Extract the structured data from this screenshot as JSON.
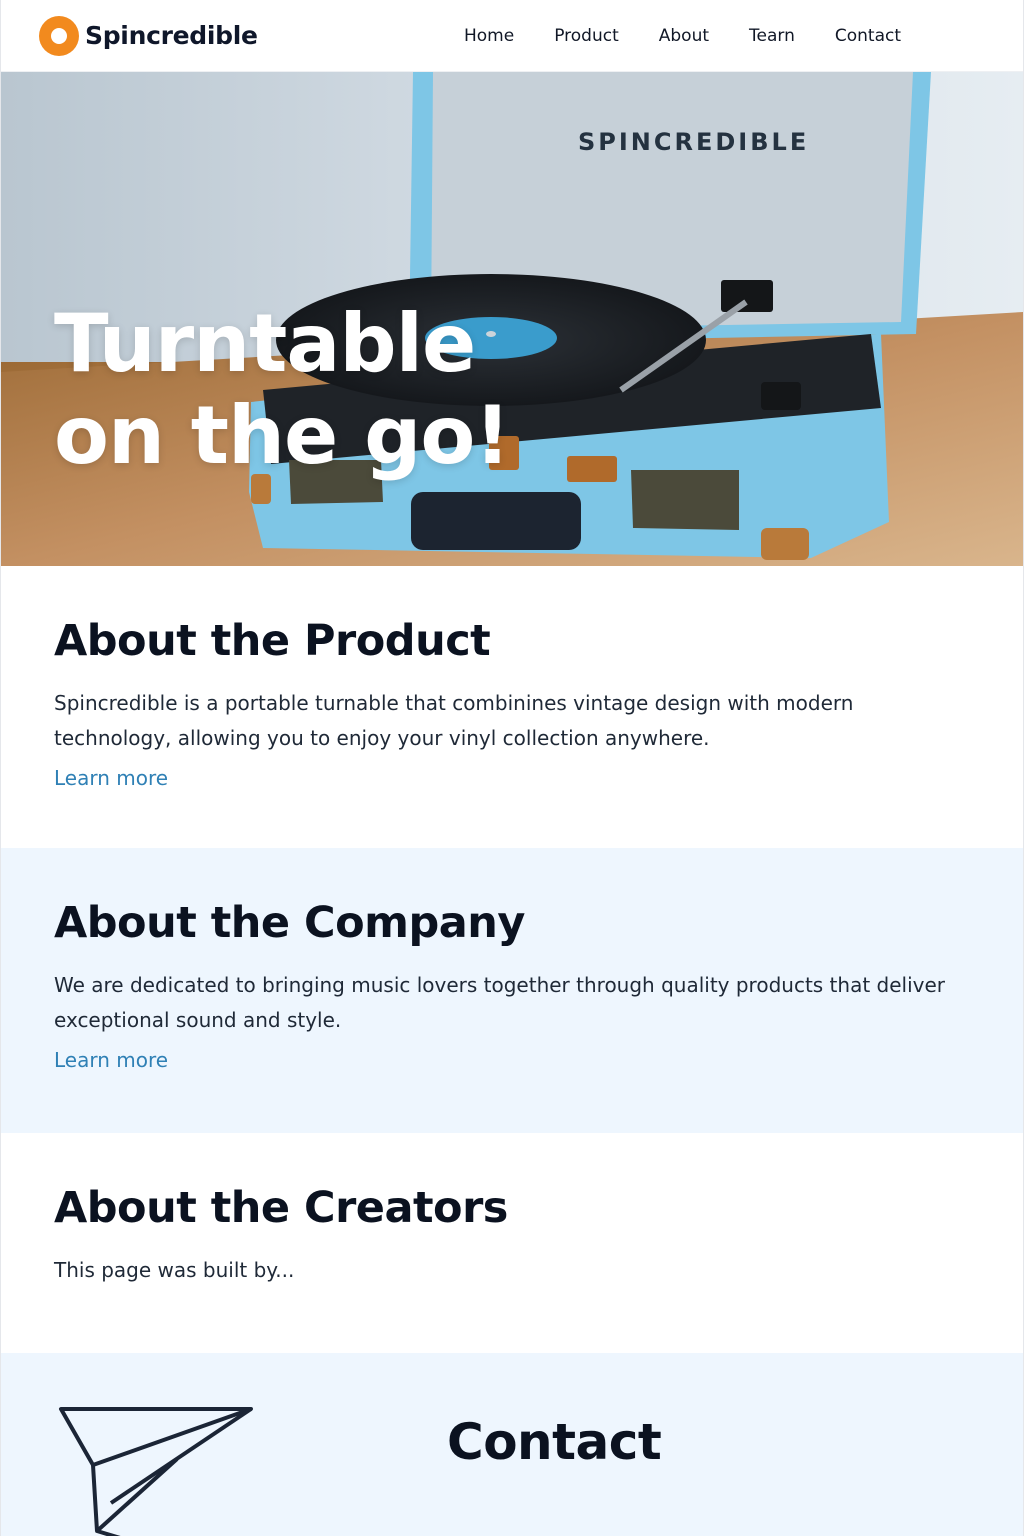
{
  "nav": {
    "brand": "Spincredible",
    "links": [
      "Home",
      "Product",
      "About",
      "Tearn",
      "Contact"
    ]
  },
  "hero": {
    "title_line1": "Turntable",
    "title_line2": "on the go!",
    "lid_text": "SPINCREDIBLE"
  },
  "product": {
    "title": "About the Product",
    "body": "Spincredible is a portable turnable that combinines vintage design with modern technology, allowing you to enjoy your vinyl collection anywhere.",
    "link": "Learn more"
  },
  "company": {
    "title": "About the Company",
    "body": "We are dedicated to bringing music lovers together through quality products that deliver exceptional sound and style.",
    "link": "Learn more"
  },
  "creators": {
    "title": "About the Creators",
    "body": "This page was built by..."
  },
  "contact": {
    "title": "Contact"
  },
  "colors": {
    "brand_orange": "#f28a1e",
    "link_blue": "#2f80b5",
    "section_tint": "#eef6fe",
    "turntable_blue": "#7ec6e6"
  }
}
